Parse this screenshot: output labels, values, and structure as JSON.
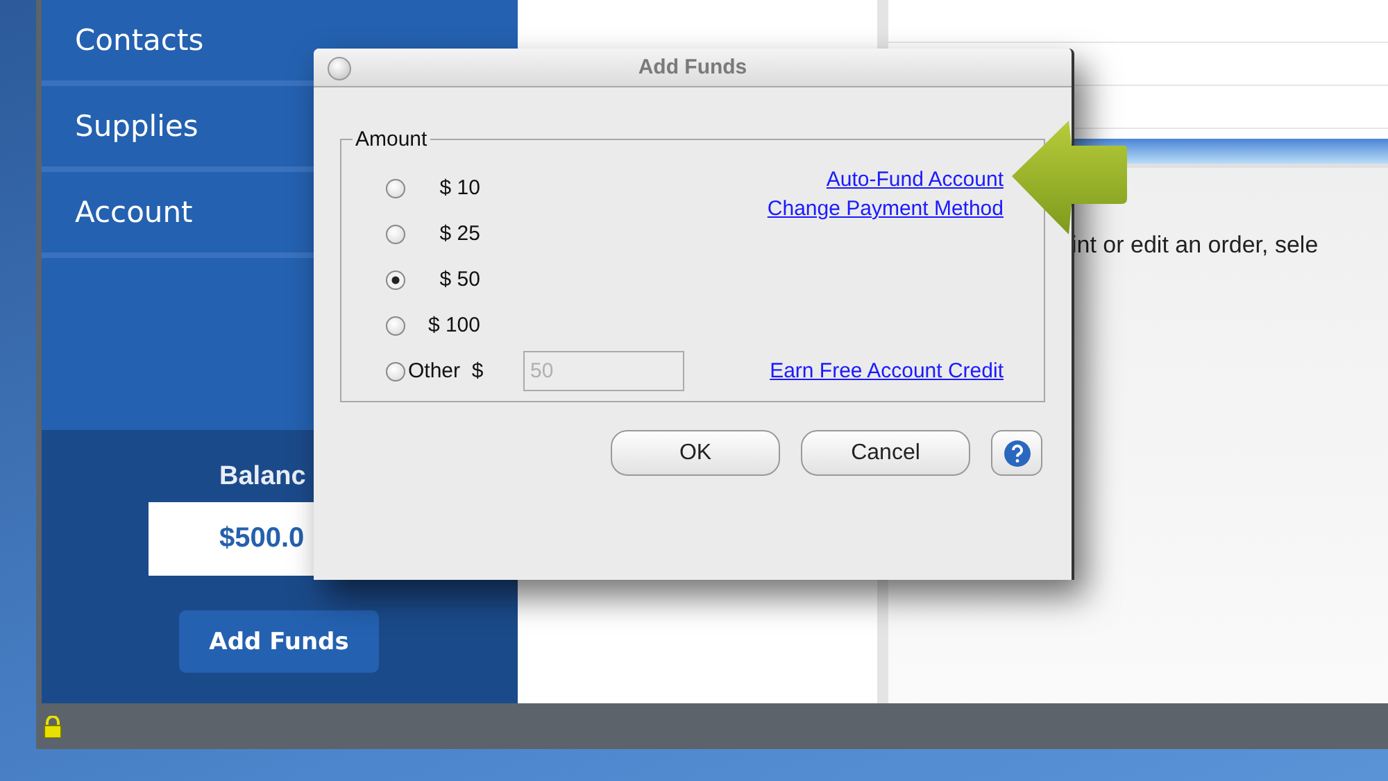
{
  "sidebar": {
    "items": [
      {
        "label": "Contacts"
      },
      {
        "label": "Supplies"
      },
      {
        "label": "Account"
      }
    ],
    "balance": {
      "label": "Balanc",
      "value": "$500.0"
    },
    "add_funds_button": "Add Funds"
  },
  "content": {
    "message": "int or edit an order, sele"
  },
  "dialog": {
    "title": "Add Funds",
    "group_label": "Amount",
    "options": [
      {
        "kind": "preset",
        "label": "$ 10",
        "selected": false
      },
      {
        "kind": "preset",
        "label": "$ 25",
        "selected": false
      },
      {
        "kind": "preset",
        "label": "$ 50",
        "selected": true
      },
      {
        "kind": "preset",
        "label": "$ 100",
        "selected": false
      },
      {
        "kind": "other",
        "label": "Other  $",
        "selected": false
      }
    ],
    "other_amount": {
      "value": "50",
      "disabled": true
    },
    "links": [
      "Auto-Fund Account",
      "Change Payment Method",
      "Earn Free Account Credit"
    ],
    "buttons": [
      "OK",
      "Cancel"
    ]
  }
}
